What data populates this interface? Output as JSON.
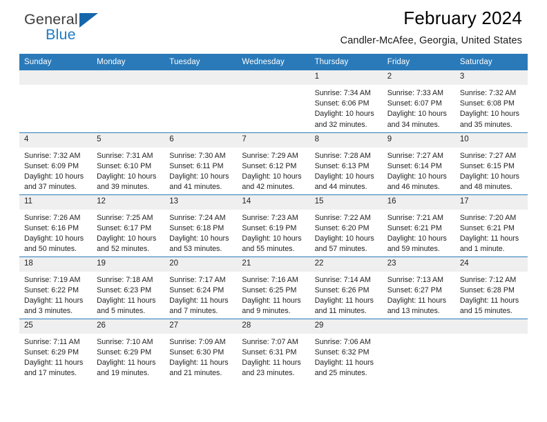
{
  "brand": {
    "name_top": "General",
    "name_bottom": "Blue",
    "accent_color": "#1f7ac4",
    "triangle_color": "#1566ab"
  },
  "header": {
    "title": "February 2024",
    "subtitle": "Candler-McAfee, Georgia, United States"
  },
  "theme": {
    "header_row_bg": "#2a7ab9",
    "daynum_bg": "#efefef",
    "row_divider": "#2a7ab9"
  },
  "weekdays": [
    "Sunday",
    "Monday",
    "Tuesday",
    "Wednesday",
    "Thursday",
    "Friday",
    "Saturday"
  ],
  "weeks": [
    [
      {
        "day": "",
        "sunrise": "",
        "sunset": "",
        "daylight": "",
        "daylight2": ""
      },
      {
        "day": "",
        "sunrise": "",
        "sunset": "",
        "daylight": "",
        "daylight2": ""
      },
      {
        "day": "",
        "sunrise": "",
        "sunset": "",
        "daylight": "",
        "daylight2": ""
      },
      {
        "day": "",
        "sunrise": "",
        "sunset": "",
        "daylight": "",
        "daylight2": ""
      },
      {
        "day": "1",
        "sunrise": "Sunrise: 7:34 AM",
        "sunset": "Sunset: 6:06 PM",
        "daylight": "Daylight: 10 hours",
        "daylight2": "and 32 minutes."
      },
      {
        "day": "2",
        "sunrise": "Sunrise: 7:33 AM",
        "sunset": "Sunset: 6:07 PM",
        "daylight": "Daylight: 10 hours",
        "daylight2": "and 34 minutes."
      },
      {
        "day": "3",
        "sunrise": "Sunrise: 7:32 AM",
        "sunset": "Sunset: 6:08 PM",
        "daylight": "Daylight: 10 hours",
        "daylight2": "and 35 minutes."
      }
    ],
    [
      {
        "day": "4",
        "sunrise": "Sunrise: 7:32 AM",
        "sunset": "Sunset: 6:09 PM",
        "daylight": "Daylight: 10 hours",
        "daylight2": "and 37 minutes."
      },
      {
        "day": "5",
        "sunrise": "Sunrise: 7:31 AM",
        "sunset": "Sunset: 6:10 PM",
        "daylight": "Daylight: 10 hours",
        "daylight2": "and 39 minutes."
      },
      {
        "day": "6",
        "sunrise": "Sunrise: 7:30 AM",
        "sunset": "Sunset: 6:11 PM",
        "daylight": "Daylight: 10 hours",
        "daylight2": "and 41 minutes."
      },
      {
        "day": "7",
        "sunrise": "Sunrise: 7:29 AM",
        "sunset": "Sunset: 6:12 PM",
        "daylight": "Daylight: 10 hours",
        "daylight2": "and 42 minutes."
      },
      {
        "day": "8",
        "sunrise": "Sunrise: 7:28 AM",
        "sunset": "Sunset: 6:13 PM",
        "daylight": "Daylight: 10 hours",
        "daylight2": "and 44 minutes."
      },
      {
        "day": "9",
        "sunrise": "Sunrise: 7:27 AM",
        "sunset": "Sunset: 6:14 PM",
        "daylight": "Daylight: 10 hours",
        "daylight2": "and 46 minutes."
      },
      {
        "day": "10",
        "sunrise": "Sunrise: 7:27 AM",
        "sunset": "Sunset: 6:15 PM",
        "daylight": "Daylight: 10 hours",
        "daylight2": "and 48 minutes."
      }
    ],
    [
      {
        "day": "11",
        "sunrise": "Sunrise: 7:26 AM",
        "sunset": "Sunset: 6:16 PM",
        "daylight": "Daylight: 10 hours",
        "daylight2": "and 50 minutes."
      },
      {
        "day": "12",
        "sunrise": "Sunrise: 7:25 AM",
        "sunset": "Sunset: 6:17 PM",
        "daylight": "Daylight: 10 hours",
        "daylight2": "and 52 minutes."
      },
      {
        "day": "13",
        "sunrise": "Sunrise: 7:24 AM",
        "sunset": "Sunset: 6:18 PM",
        "daylight": "Daylight: 10 hours",
        "daylight2": "and 53 minutes."
      },
      {
        "day": "14",
        "sunrise": "Sunrise: 7:23 AM",
        "sunset": "Sunset: 6:19 PM",
        "daylight": "Daylight: 10 hours",
        "daylight2": "and 55 minutes."
      },
      {
        "day": "15",
        "sunrise": "Sunrise: 7:22 AM",
        "sunset": "Sunset: 6:20 PM",
        "daylight": "Daylight: 10 hours",
        "daylight2": "and 57 minutes."
      },
      {
        "day": "16",
        "sunrise": "Sunrise: 7:21 AM",
        "sunset": "Sunset: 6:21 PM",
        "daylight": "Daylight: 10 hours",
        "daylight2": "and 59 minutes."
      },
      {
        "day": "17",
        "sunrise": "Sunrise: 7:20 AM",
        "sunset": "Sunset: 6:21 PM",
        "daylight": "Daylight: 11 hours",
        "daylight2": "and 1 minute."
      }
    ],
    [
      {
        "day": "18",
        "sunrise": "Sunrise: 7:19 AM",
        "sunset": "Sunset: 6:22 PM",
        "daylight": "Daylight: 11 hours",
        "daylight2": "and 3 minutes."
      },
      {
        "day": "19",
        "sunrise": "Sunrise: 7:18 AM",
        "sunset": "Sunset: 6:23 PM",
        "daylight": "Daylight: 11 hours",
        "daylight2": "and 5 minutes."
      },
      {
        "day": "20",
        "sunrise": "Sunrise: 7:17 AM",
        "sunset": "Sunset: 6:24 PM",
        "daylight": "Daylight: 11 hours",
        "daylight2": "and 7 minutes."
      },
      {
        "day": "21",
        "sunrise": "Sunrise: 7:16 AM",
        "sunset": "Sunset: 6:25 PM",
        "daylight": "Daylight: 11 hours",
        "daylight2": "and 9 minutes."
      },
      {
        "day": "22",
        "sunrise": "Sunrise: 7:14 AM",
        "sunset": "Sunset: 6:26 PM",
        "daylight": "Daylight: 11 hours",
        "daylight2": "and 11 minutes."
      },
      {
        "day": "23",
        "sunrise": "Sunrise: 7:13 AM",
        "sunset": "Sunset: 6:27 PM",
        "daylight": "Daylight: 11 hours",
        "daylight2": "and 13 minutes."
      },
      {
        "day": "24",
        "sunrise": "Sunrise: 7:12 AM",
        "sunset": "Sunset: 6:28 PM",
        "daylight": "Daylight: 11 hours",
        "daylight2": "and 15 minutes."
      }
    ],
    [
      {
        "day": "25",
        "sunrise": "Sunrise: 7:11 AM",
        "sunset": "Sunset: 6:29 PM",
        "daylight": "Daylight: 11 hours",
        "daylight2": "and 17 minutes."
      },
      {
        "day": "26",
        "sunrise": "Sunrise: 7:10 AM",
        "sunset": "Sunset: 6:29 PM",
        "daylight": "Daylight: 11 hours",
        "daylight2": "and 19 minutes."
      },
      {
        "day": "27",
        "sunrise": "Sunrise: 7:09 AM",
        "sunset": "Sunset: 6:30 PM",
        "daylight": "Daylight: 11 hours",
        "daylight2": "and 21 minutes."
      },
      {
        "day": "28",
        "sunrise": "Sunrise: 7:07 AM",
        "sunset": "Sunset: 6:31 PM",
        "daylight": "Daylight: 11 hours",
        "daylight2": "and 23 minutes."
      },
      {
        "day": "29",
        "sunrise": "Sunrise: 7:06 AM",
        "sunset": "Sunset: 6:32 PM",
        "daylight": "Daylight: 11 hours",
        "daylight2": "and 25 minutes."
      },
      {
        "day": "",
        "sunrise": "",
        "sunset": "",
        "daylight": "",
        "daylight2": ""
      },
      {
        "day": "",
        "sunrise": "",
        "sunset": "",
        "daylight": "",
        "daylight2": ""
      }
    ]
  ]
}
